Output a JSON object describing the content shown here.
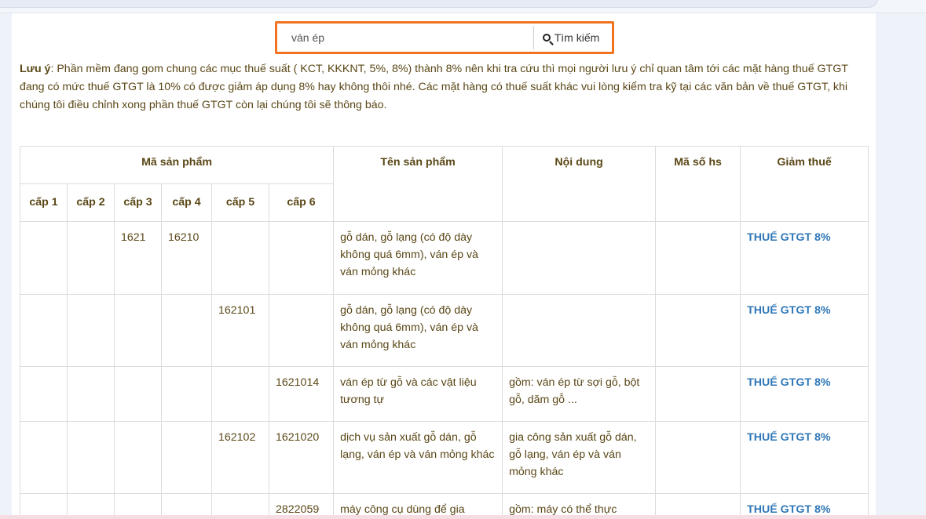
{
  "search": {
    "value": "ván ép",
    "button_label": "Tìm kiếm",
    "icon": "search-icon"
  },
  "note": {
    "label": "Lưu ý",
    "text": ": Phần mềm đang gom chung các mục thuế suất ( KCT, KKKNT, 5%, 8%) thành 8% nên khi tra cứu thì mọi người lưu ý chỉ quan tâm tới các mặt hàng thuế GTGT đang có mức thuế GTGT là 10% có được giảm áp dụng 8% hay không thôi nhé. Các mặt hàng có thuế suất khác vui lòng kiểm tra kỹ tại các văn bản về thuế GTGT, khi chúng tôi điều chỉnh xong phần thuế GTGT còn lại chúng tôi sẽ thông báo."
  },
  "table": {
    "group_header": "Mã sản phẩm",
    "level_headers": [
      "cấp 1",
      "cấp 2",
      "cấp 3",
      "cấp 4",
      "cấp 5",
      "cấp 6"
    ],
    "col_name": "Tên sản phẩm",
    "col_content": "Nội dung",
    "col_hs": "Mã số hs",
    "col_tax": "Giảm thuế",
    "rows": [
      {
        "c1": "",
        "c2": "",
        "c3": "1621",
        "c4": "16210",
        "c5": "",
        "c6": "",
        "name": "gỗ dán, gỗ lạng (có độ dày không quá 6mm), ván ép và ván mỏng khác",
        "content": "",
        "hs": "",
        "tax": "THUẾ GTGT 8%"
      },
      {
        "c1": "",
        "c2": "",
        "c3": "",
        "c4": "",
        "c5": "162101",
        "c6": "",
        "name": "gỗ dán, gỗ lạng (có độ dày không quá 6mm), ván ép và ván mỏng khác",
        "content": "",
        "hs": "",
        "tax": "THUẾ GTGT 8%"
      },
      {
        "c1": "",
        "c2": "",
        "c3": "",
        "c4": "",
        "c5": "",
        "c6": "1621014",
        "name": "ván ép từ gỗ và các vật liệu tương tự",
        "content": "gồm: ván ép từ sợi gỗ, bột gỗ, dăm gỗ ...",
        "hs": "",
        "tax": "THUẾ GTGT 8%"
      },
      {
        "c1": "",
        "c2": "",
        "c3": "",
        "c4": "",
        "c5": "162102",
        "c6": "1621020",
        "name": "dịch vụ sản xuất gỗ dán, gỗ lạng, ván ép và ván mỏng khác",
        "content": "gia công sản xuất gỗ dán, gỗ lạng, ván ép và ván mỏng khác",
        "hs": "",
        "tax": "THUẾ GTGT 8%"
      },
      {
        "c1": "",
        "c2": "",
        "c3": "",
        "c4": "",
        "c5": "",
        "c6": "2822059",
        "name": "máy công cụ dùng để gia",
        "content": "gồm: máy có thể thực",
        "hs": "",
        "tax": "THUẾ GTGT 8%"
      }
    ]
  }
}
